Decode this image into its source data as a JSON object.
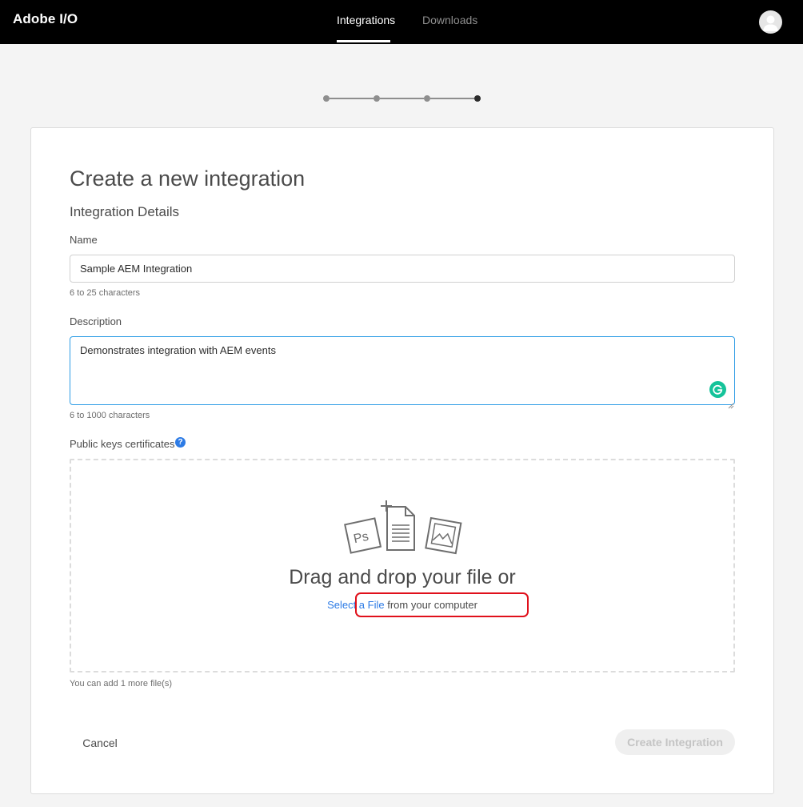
{
  "header": {
    "brand": "Adobe I/O",
    "tabs": [
      {
        "label": "Integrations",
        "active": true
      },
      {
        "label": "Downloads",
        "active": false
      }
    ]
  },
  "stepper": {
    "total_steps": 4,
    "current_step": 4
  },
  "form": {
    "title": "Create a new integration",
    "section_title": "Integration Details",
    "name": {
      "label": "Name",
      "value": "Sample AEM Integration",
      "hint": "6 to 25 characters"
    },
    "description": {
      "label": "Description",
      "value": "Demonstrates integration with AEM events",
      "hint": "6 to 1000 characters"
    },
    "public_keys": {
      "label": "Public keys certificates",
      "help_icon": "?",
      "drop_title": "Drag and drop your file or",
      "select_link": "Select a File",
      "select_suffix": "from your computer",
      "hint": "You can add 1 more file(s)"
    }
  },
  "actions": {
    "cancel_label": "Cancel",
    "create_label": "Create Integration"
  },
  "illustration": {
    "ps_icon_text": "Ps"
  },
  "colors": {
    "link_blue": "#2d7be5",
    "focus_blue": "#2d9ce5",
    "highlight_red": "#e0101b",
    "grammarly_green": "#15c39a"
  }
}
